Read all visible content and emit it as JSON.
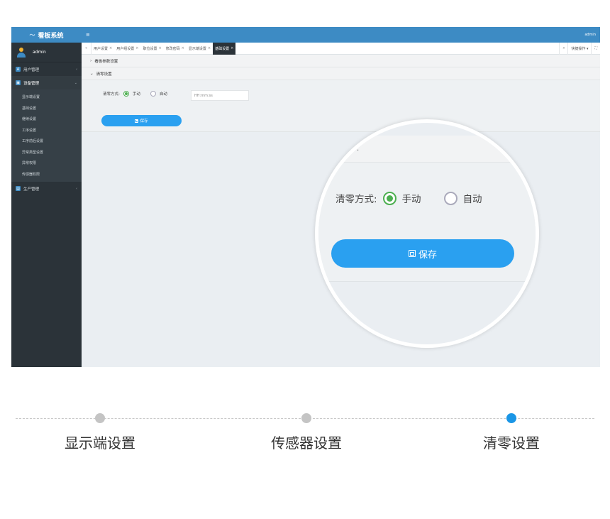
{
  "app": {
    "title": "看板系统",
    "user": "admin",
    "top_user": "admin"
  },
  "sidebar": {
    "groups": [
      {
        "label": "用户管理",
        "icon": "user-manage-icon"
      },
      {
        "label": "设备管理",
        "icon": "device-manage-icon"
      },
      {
        "label": "生产管理",
        "icon": "production-manage-icon"
      }
    ],
    "device_items": [
      "显示端设置",
      "基础设置",
      "继续设置",
      "工序设置",
      "工序前后设置",
      "异常类型设置",
      "异常权限",
      "传感器权限"
    ]
  },
  "tabs": {
    "items": [
      "用户设置",
      "用户组设置",
      "职位设置",
      "修改密码",
      "显示端设置",
      "基础设置"
    ],
    "active": "基础设置",
    "close": "×",
    "quick_ops": "快捷操作 ▾",
    "nav_prev": "«",
    "nav_next": "»",
    "fullscreen": "⛶"
  },
  "content": {
    "panel1_title": "看板参数设置",
    "panel2_title": "清零设置",
    "mode_label": "清零方式:",
    "option_manual": "手动",
    "option_auto": "自动",
    "time_placeholder": "HH:mm:ss",
    "save_label": "保存"
  },
  "magnifier": {
    "mode_label": "清零方式:",
    "option_manual": "手动",
    "option_auto": "自动",
    "save_label": "保存"
  },
  "steps": [
    "显示端设置",
    "传感器设置",
    "清零设置"
  ],
  "active_step": 2,
  "colors": {
    "accent": "#3d8bc4",
    "button": "#2aa0f0",
    "active_step": "#1a96e6",
    "sidebar": "#2b3339"
  }
}
